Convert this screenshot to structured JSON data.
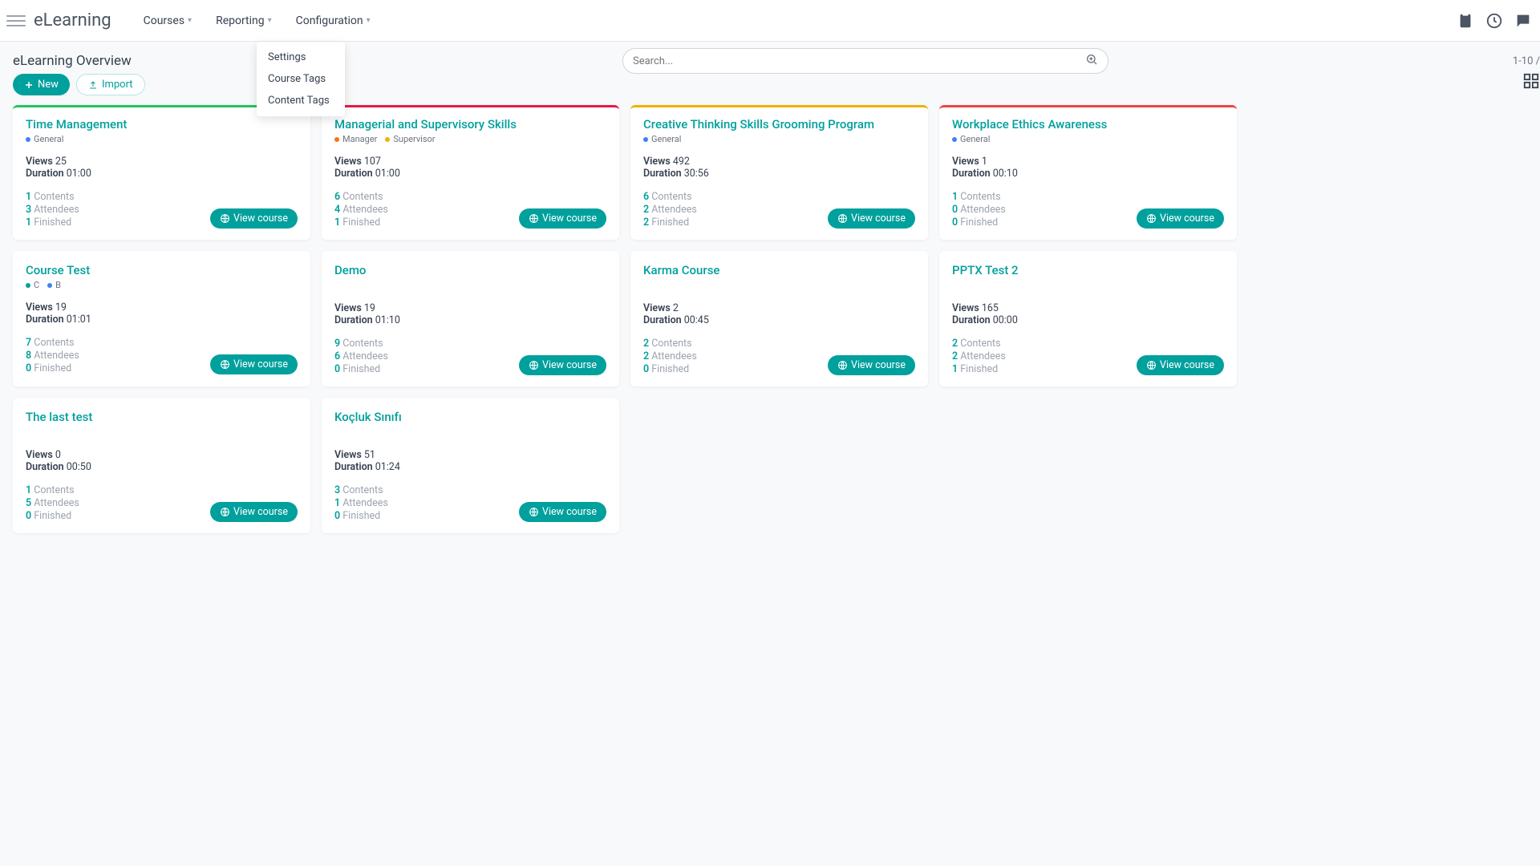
{
  "brand": "eLearning",
  "nav": {
    "courses": "Courses",
    "reporting": "Reporting",
    "configuration": "Configuration"
  },
  "dropdown": {
    "settings": "Settings",
    "course_tags": "Course Tags",
    "content_tags": "Content Tags"
  },
  "page_title": "eLearning Overview",
  "buttons": {
    "new": "New",
    "import": "Import",
    "view_course": "View course"
  },
  "search": {
    "placeholder": "Search..."
  },
  "pager": "1-10 /",
  "labels": {
    "views": "Views",
    "duration": "Duration",
    "contents": "Contents",
    "attendees": "Attendees",
    "finished": "Finished"
  },
  "cards": [
    {
      "title": "Time Management",
      "border": "green",
      "tags": [
        {
          "color": "blue",
          "label": "General"
        }
      ],
      "views": "25",
      "duration": "01:00",
      "contents": "1",
      "attendees": "3",
      "finished": "1"
    },
    {
      "title": "Managerial and Supervisory Skills",
      "border": "pink",
      "tags": [
        {
          "color": "orange",
          "label": "Manager"
        },
        {
          "color": "yellow",
          "label": "Supervisor"
        }
      ],
      "views": "107",
      "duration": "01:00",
      "contents": "6",
      "attendees": "4",
      "finished": "1"
    },
    {
      "title": "Creative Thinking Skills Grooming Program",
      "border": "yellow",
      "tags": [
        {
          "color": "blue",
          "label": "General"
        }
      ],
      "views": "492",
      "duration": "30:56",
      "contents": "6",
      "attendees": "2",
      "finished": "2"
    },
    {
      "title": "Workplace Ethics Awareness",
      "border": "red",
      "tags": [
        {
          "color": "blue",
          "label": "General"
        }
      ],
      "views": "1",
      "duration": "00:10",
      "contents": "1",
      "attendees": "0",
      "finished": "0"
    },
    {
      "title": "Course Test",
      "border": "none",
      "tags": [
        {
          "color": "teal",
          "label": "C"
        },
        {
          "color": "blue",
          "label": "B"
        }
      ],
      "views": "19",
      "duration": "01:01",
      "contents": "7",
      "attendees": "8",
      "finished": "0"
    },
    {
      "title": "Demo",
      "border": "none",
      "tags": [],
      "views": "19",
      "duration": "01:10",
      "contents": "9",
      "attendees": "6",
      "finished": "0"
    },
    {
      "title": "Karma Course",
      "border": "none",
      "tags": [],
      "views": "2",
      "duration": "00:45",
      "contents": "2",
      "attendees": "2",
      "finished": "0"
    },
    {
      "title": "PPTX Test 2",
      "border": "none",
      "tags": [],
      "views": "165",
      "duration": "00:00",
      "contents": "2",
      "attendees": "2",
      "finished": "1"
    },
    {
      "title": "The last test",
      "border": "none",
      "tags": [],
      "views": "0",
      "duration": "00:50",
      "contents": "1",
      "attendees": "5",
      "finished": "0"
    },
    {
      "title": "Koçluk Sınıfı",
      "border": "none",
      "tags": [],
      "views": "51",
      "duration": "01:24",
      "contents": "3",
      "attendees": "1",
      "finished": "0"
    }
  ]
}
